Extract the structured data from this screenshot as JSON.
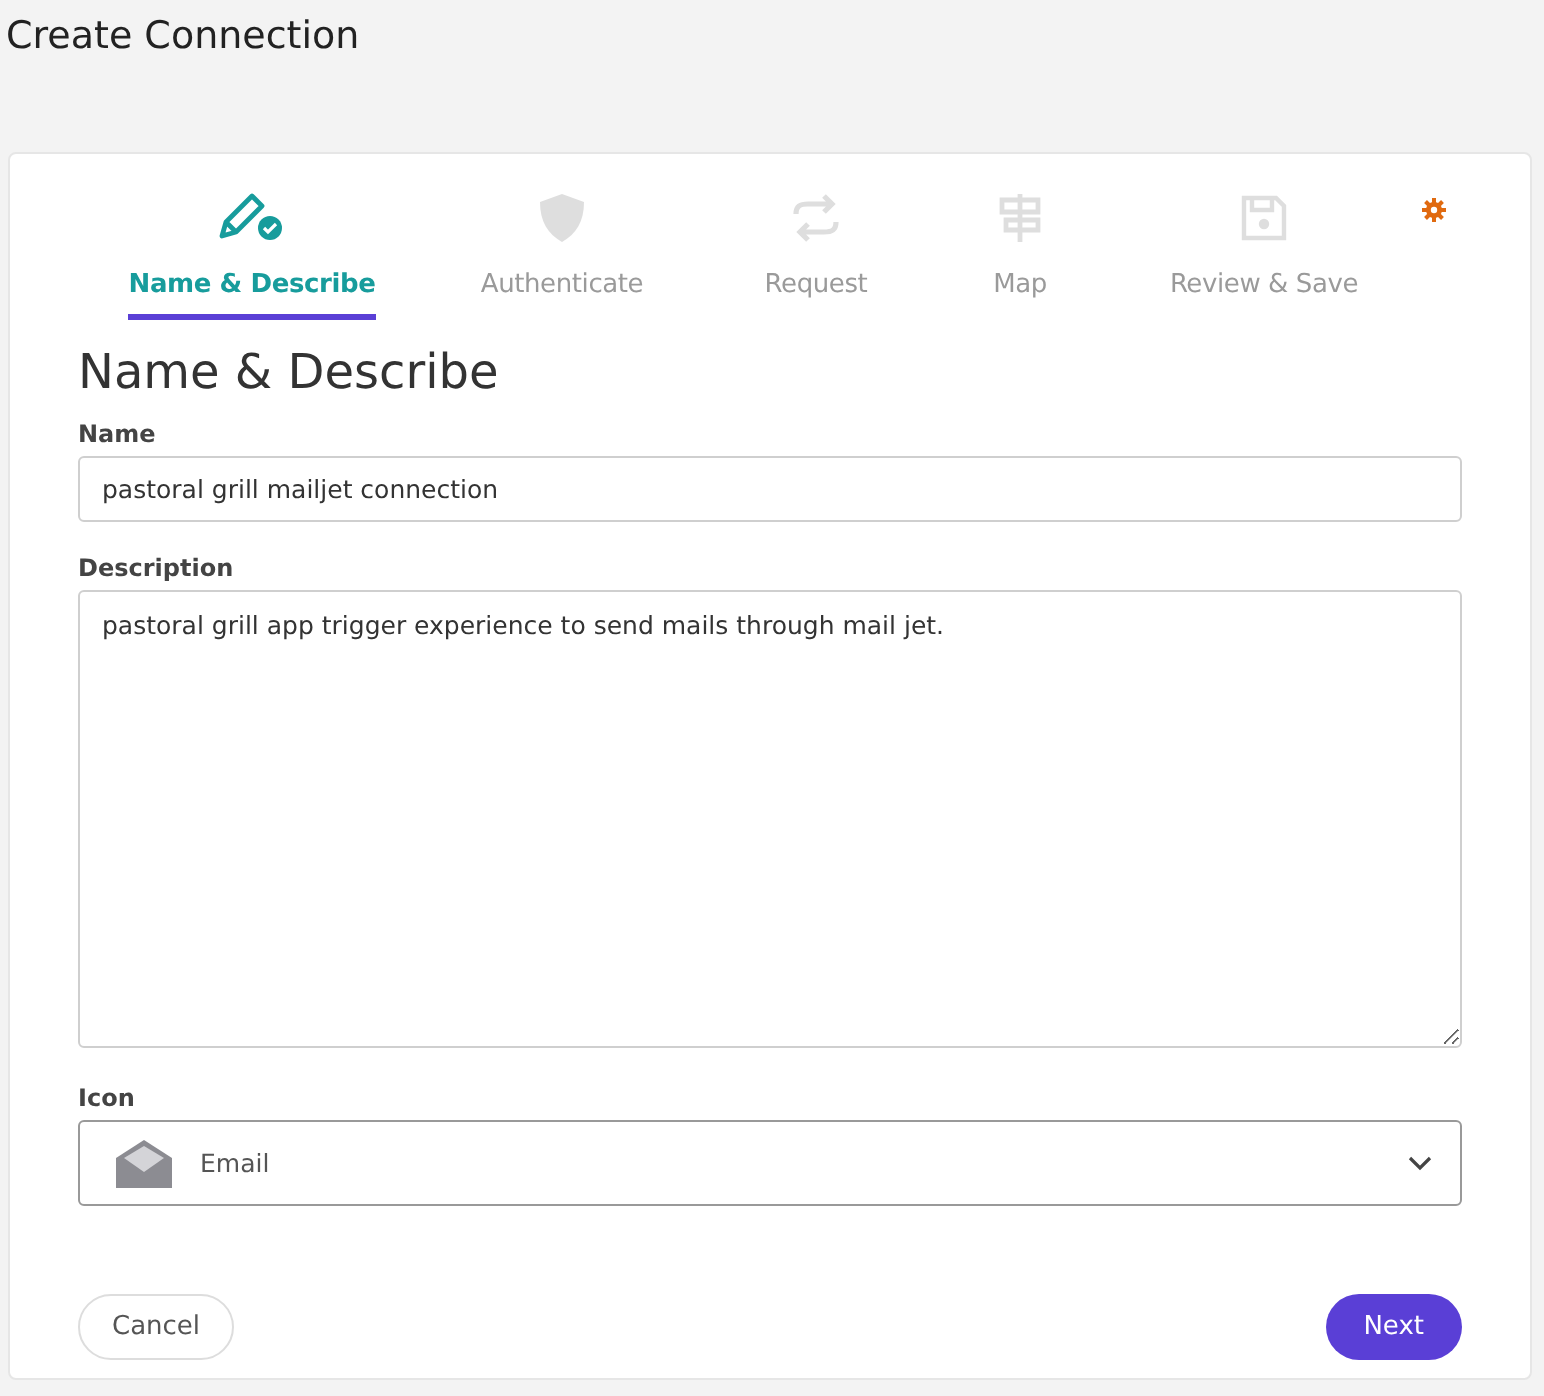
{
  "page": {
    "title": "Create Connection"
  },
  "steps": [
    {
      "label": "Name & Describe",
      "selected": true,
      "kind": "pencil"
    },
    {
      "label": "Authenticate",
      "selected": false,
      "kind": "shield"
    },
    {
      "label": "Request",
      "selected": false,
      "kind": "swap"
    },
    {
      "label": "Map",
      "selected": false,
      "kind": "signpost"
    },
    {
      "label": "Review & Save",
      "selected": false,
      "kind": "save"
    }
  ],
  "form": {
    "heading": "Name & Describe",
    "name": {
      "label": "Name",
      "value": "pastoral grill mailjet connection"
    },
    "description": {
      "label": "Description",
      "value": "pastoral grill app trigger experience to send mails through mail jet."
    },
    "icon": {
      "label": "Icon",
      "value": "Email"
    }
  },
  "buttons": {
    "cancel": "Cancel",
    "next": "Next"
  }
}
